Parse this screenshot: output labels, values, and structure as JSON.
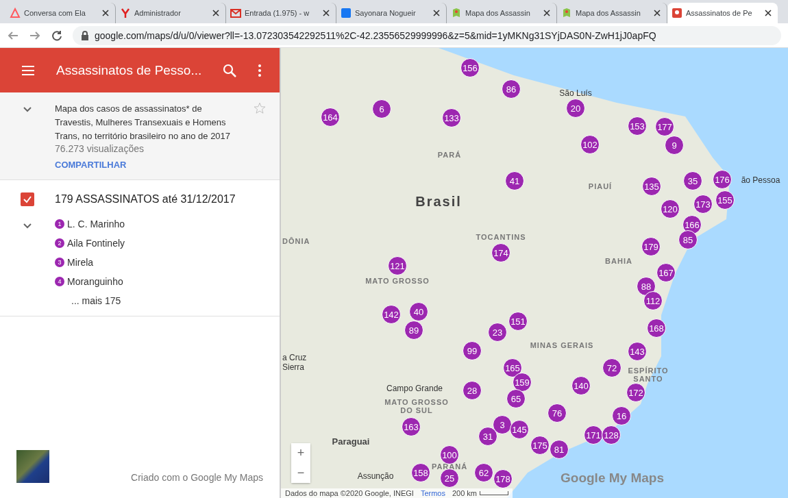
{
  "browser": {
    "tabs": [
      {
        "title": "Conversa com Ela",
        "kind": "triangle",
        "selected": false
      },
      {
        "title": "Administrador",
        "kind": "letter",
        "selected": false
      },
      {
        "title": "Entrada (1.975) - w",
        "kind": "mail",
        "selected": false
      },
      {
        "title": "Sayonara Nogueir",
        "kind": "square",
        "selected": false
      },
      {
        "title": "Mapa dos Assassin",
        "kind": "map",
        "selected": false
      },
      {
        "title": "Mapa dos Assassin",
        "kind": "map",
        "selected": false
      },
      {
        "title": "Assassinatos de Pe",
        "kind": "pin",
        "selected": true
      }
    ],
    "url": "google.com/maps/d/u/0/viewer?ll=-13.072303542292511%2C-42.23556529999996&z=5&mid=1yMKNg31SYjDAS0N-ZwH1jJ0apFQ"
  },
  "header": {
    "title": "Assassinatos de Pesso..."
  },
  "description": {
    "text": "Mapa dos casos de assassinatos* de Travestis, Mulheres Transexuais e Homens Trans, no território brasileiro no ano de 2017",
    "views": "76.273 visualizações",
    "share": "COMPARTILHAR",
    "starred": false
  },
  "layer": {
    "title": "179 ASSASSINATOS até 31/12/2017",
    "checked": true,
    "expanded": true,
    "items": [
      {
        "number": "1",
        "name": "L. C. Marinho"
      },
      {
        "number": "2",
        "name": "Aila Fontinely"
      },
      {
        "number": "3",
        "name": "Mirela"
      },
      {
        "number": "4",
        "name": "Moranguinho"
      }
    ],
    "more": "... mais 175"
  },
  "footer": {
    "credit": "Criado com o Google My Maps"
  },
  "map": {
    "places": [
      {
        "label": "São Luís",
        "kind": "city"
      },
      {
        "label": "PARÁ",
        "kind": "region"
      },
      {
        "label": "PIAUÍ",
        "kind": "region"
      },
      {
        "label": "ão Pessoa",
        "kind": "city"
      },
      {
        "label": "Brasil",
        "kind": "country"
      },
      {
        "label": "DÔNIA",
        "kind": "region"
      },
      {
        "label": "TOCANTINS",
        "kind": "region"
      },
      {
        "label": "BAHIA",
        "kind": "region"
      },
      {
        "label": "MATO GROSSO",
        "kind": "region"
      },
      {
        "label": "MINAS GERAIS",
        "kind": "region"
      },
      {
        "label": "a Cruz",
        "kind": "city"
      },
      {
        "label": "Sierra",
        "kind": "city"
      },
      {
        "label": "ESPÍRITO",
        "kind": "region"
      },
      {
        "label": "SANTO",
        "kind": "region"
      },
      {
        "label": "Campo Grande",
        "kind": "city"
      },
      {
        "label": "MATO GROSSO",
        "kind": "region"
      },
      {
        "label": "DO SUL",
        "kind": "region"
      },
      {
        "label": "Paraguai",
        "kind": "country_small"
      },
      {
        "label": "PARANÁ",
        "kind": "region"
      },
      {
        "label": "Assunção",
        "kind": "city"
      }
    ],
    "pins": [
      "156",
      "86",
      "164",
      "6",
      "133",
      "20",
      "153",
      "177",
      "102",
      "9",
      "41",
      "135",
      "35",
      "176",
      "155",
      "173",
      "120",
      "166",
      "174",
      "179",
      "85",
      "121",
      "167",
      "88",
      "112",
      "142",
      "89",
      "40",
      "23",
      "151",
      "168",
      "99",
      "143",
      "165",
      "72",
      "28",
      "159",
      "140",
      "172",
      "65",
      "76",
      "16",
      "163",
      "31",
      "3",
      "145",
      "171",
      "128",
      "175",
      "81",
      "100",
      "158",
      "25",
      "62",
      "178"
    ],
    "zoom_in": "+",
    "zoom_out": "−",
    "logo": "Google My Maps",
    "attribution": "Dados do mapa ©2020 Google, INEGI",
    "terms": "Termos",
    "scale": "200 km"
  }
}
